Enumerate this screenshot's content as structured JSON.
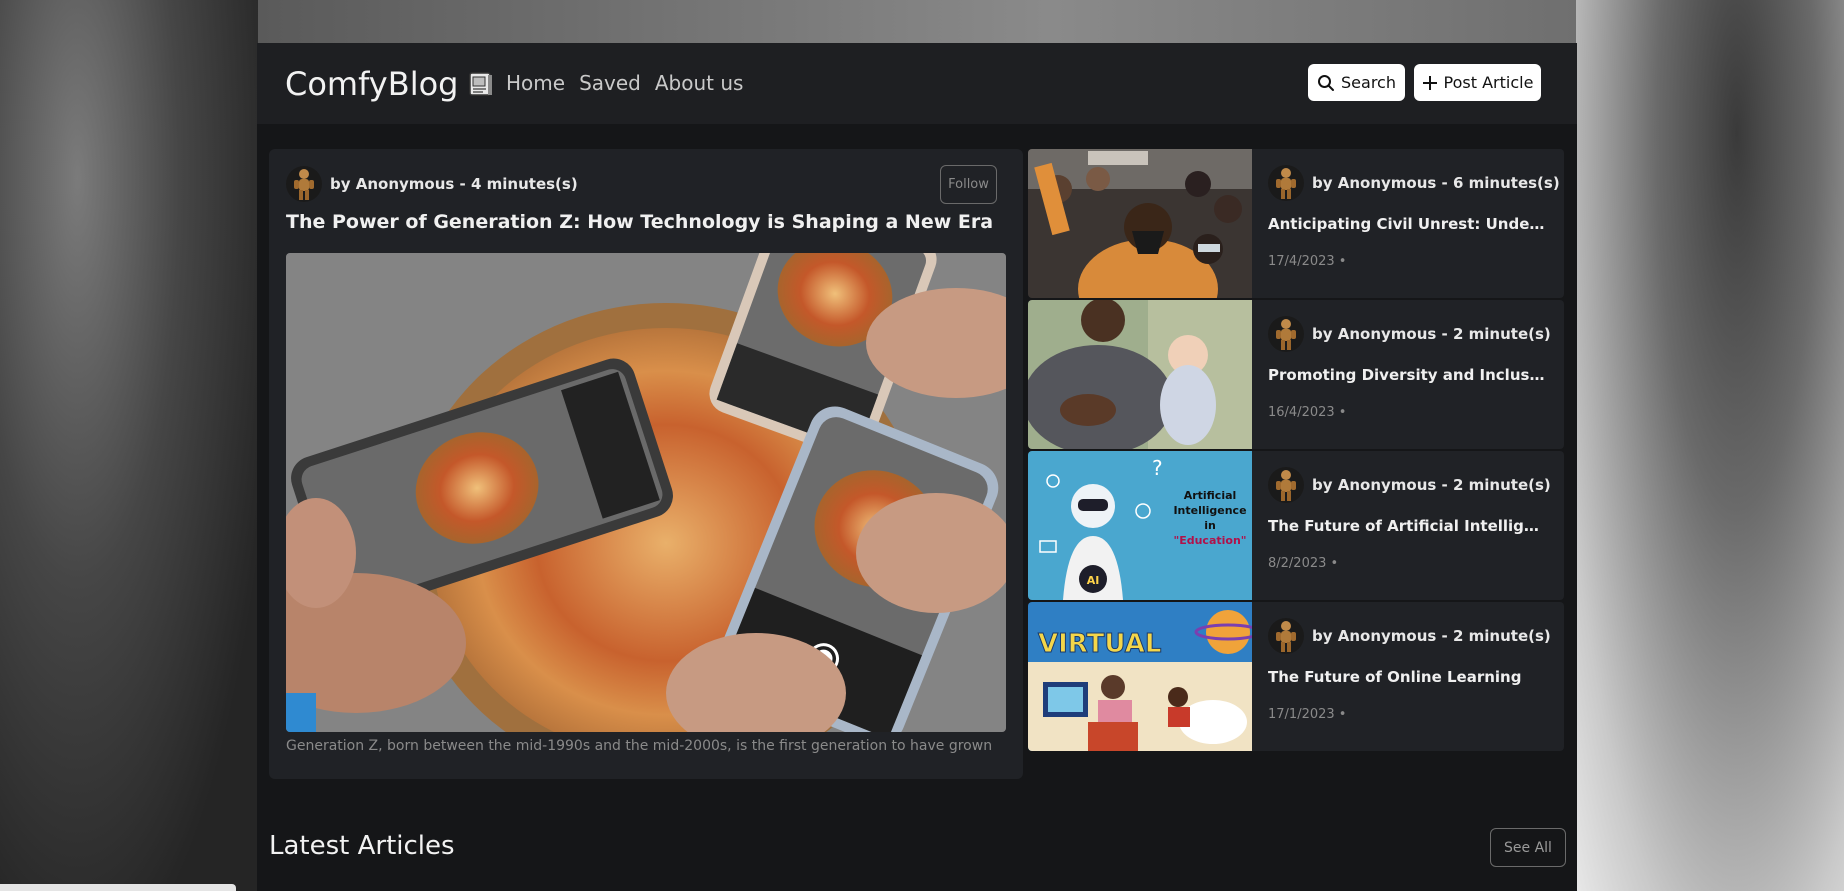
{
  "navbar": {
    "brand": "ComfyBlog",
    "brand_icon": "book-icon",
    "links": [
      "Home",
      "Saved",
      "About us"
    ],
    "search_label": "Search",
    "post_label": "Post Article"
  },
  "featured": {
    "author_line": "by Anonymous - 4 minutes(s)",
    "follow_label": "Follow",
    "title": "The Power of Generation Z: How Technology is Shaping a New Era",
    "excerpt": "Generation Z, born between the mid-1990s and the mid-2000s, is the first generation to have grown"
  },
  "side_articles": [
    {
      "author_line": "by Anonymous - 6 minutes(s)",
      "title": "Anticipating Civil Unrest: Understanding the Signs",
      "date": "17/4/2023 •"
    },
    {
      "author_line": "by Anonymous - 2 minute(s)",
      "title": "Promoting Diversity and Inclusion in Healthcare",
      "date": "16/4/2023 •"
    },
    {
      "author_line": "by Anonymous - 2 minute(s)",
      "title": "The Future of Artificial Intelligence in Education",
      "date": "8/2/2023 •"
    },
    {
      "author_line": "by Anonymous - 2 minute(s)",
      "title": "The Future of Online Learning",
      "date": "17/1/2023 •"
    }
  ],
  "thumb_texts": {
    "ai_line1": "Artificial",
    "ai_line2": "Intelligence",
    "ai_line3": "in",
    "ai_line4": "\"Education\"",
    "ai_badge": "AI",
    "virtual": "VIRTUAL"
  },
  "latest": {
    "title": "Latest Articles",
    "see_all": "See All"
  },
  "colors": {
    "page_bg": "#151618",
    "card_bg": "#202226",
    "nav_bg": "#1e1f22",
    "text": "#f0f0f0",
    "muted": "#8a8a8a"
  }
}
